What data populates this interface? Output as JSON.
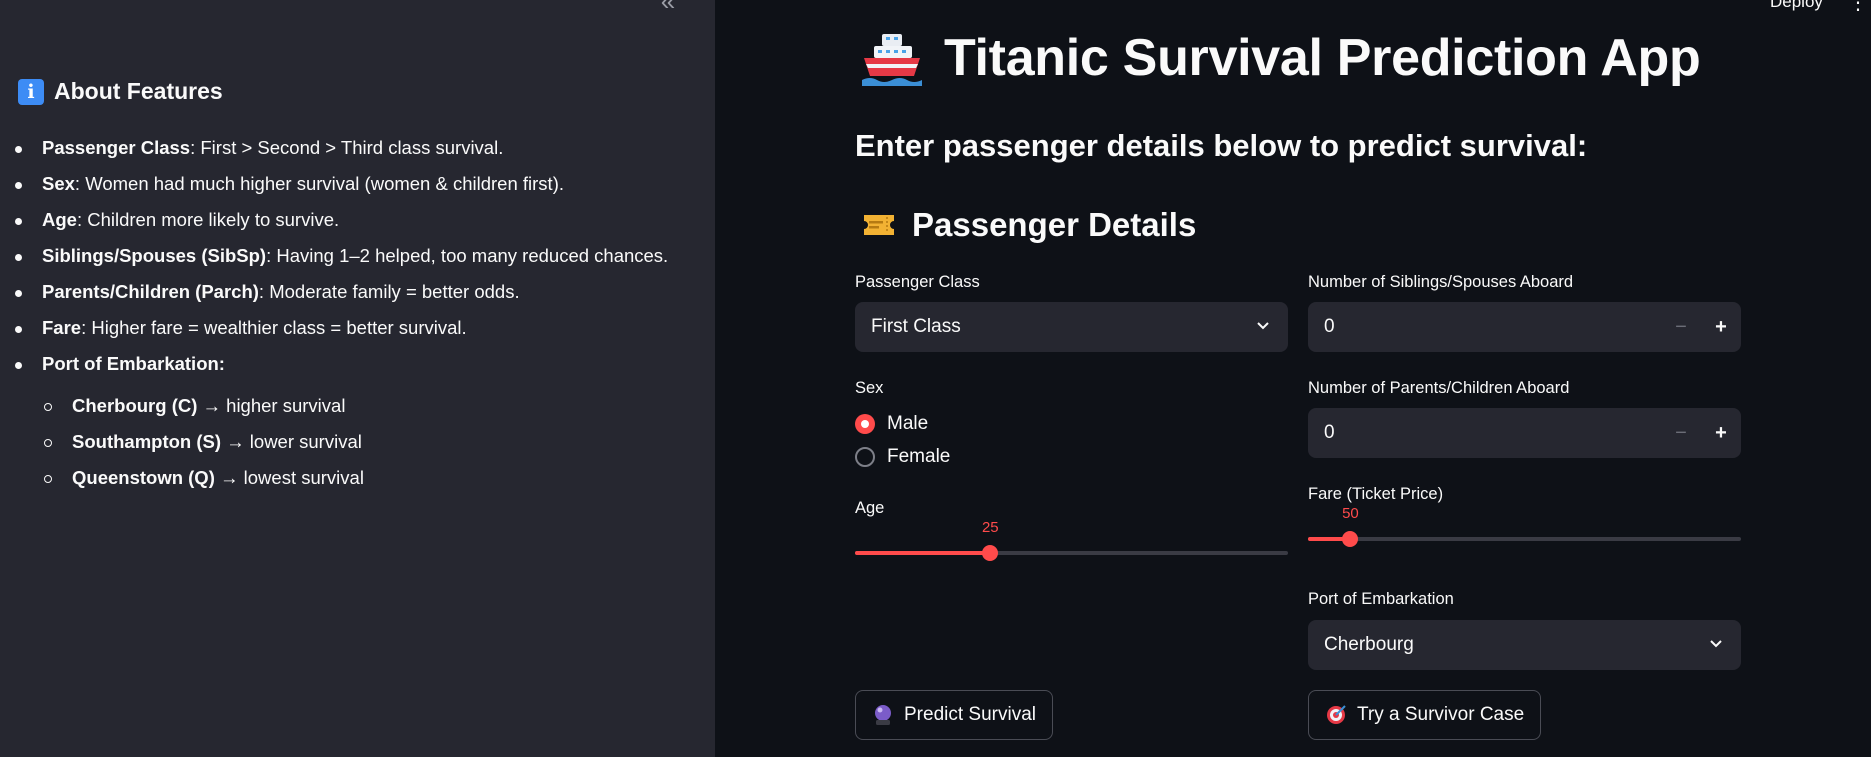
{
  "topbar": {
    "deploy_label": "Deploy",
    "menu_glyph": "⋮"
  },
  "sidebar": {
    "collapse_glyph": "«",
    "heading": "About Features",
    "features": [
      {
        "term": "Passenger Class",
        "desc": ": First > Second > Third class survival."
      },
      {
        "term": "Sex",
        "desc": ": Women had much higher survival (women & children first)."
      },
      {
        "term": "Age",
        "desc": ": Children more likely to survive."
      },
      {
        "term": "Siblings/Spouses (SibSp)",
        "desc": ": Having 1–2 helped, too many reduced chances."
      },
      {
        "term": "Parents/Children (Parch)",
        "desc": ": Moderate family = better odds."
      },
      {
        "term": "Fare",
        "desc": ": Higher fare = wealthier class = better survival."
      },
      {
        "term": "Port of Embarkation:",
        "desc": ""
      }
    ],
    "ports": [
      {
        "term": "Cherbourg (C)",
        "desc": " → higher survival"
      },
      {
        "term": "Southampton (S)",
        "desc": " → lower survival"
      },
      {
        "term": "Queenstown (Q)",
        "desc": " → lowest survival"
      }
    ]
  },
  "main": {
    "title": "Titanic Survival Prediction App",
    "subheading": "Enter passenger details below to predict survival:",
    "section_title": "Passenger Details",
    "passenger_class": {
      "label": "Passenger Class",
      "value": "First Class"
    },
    "sex": {
      "label": "Sex",
      "options": [
        "Male",
        "Female"
      ],
      "selected": "Male"
    },
    "age": {
      "label": "Age",
      "value": "25",
      "fraction": 0.3125
    },
    "sibsp": {
      "label": "Number of Siblings/Spouses Aboard",
      "value": "0"
    },
    "parch": {
      "label": "Number of Parents/Children Aboard",
      "value": "0"
    },
    "fare": {
      "label": "Fare (Ticket Price)",
      "value": "50",
      "fraction": 0.098
    },
    "embarked": {
      "label": "Port of Embarkation",
      "value": "Cherbourg"
    },
    "predict_button": "Predict Survival",
    "survivor_button": "Try a Survivor Case",
    "stepper_minus": "−",
    "stepper_plus": "+"
  },
  "colors": {
    "accent": "#ff4b4b",
    "sidebar_bg": "#262730",
    "main_bg": "#0e1117",
    "input_bg": "#262730"
  }
}
